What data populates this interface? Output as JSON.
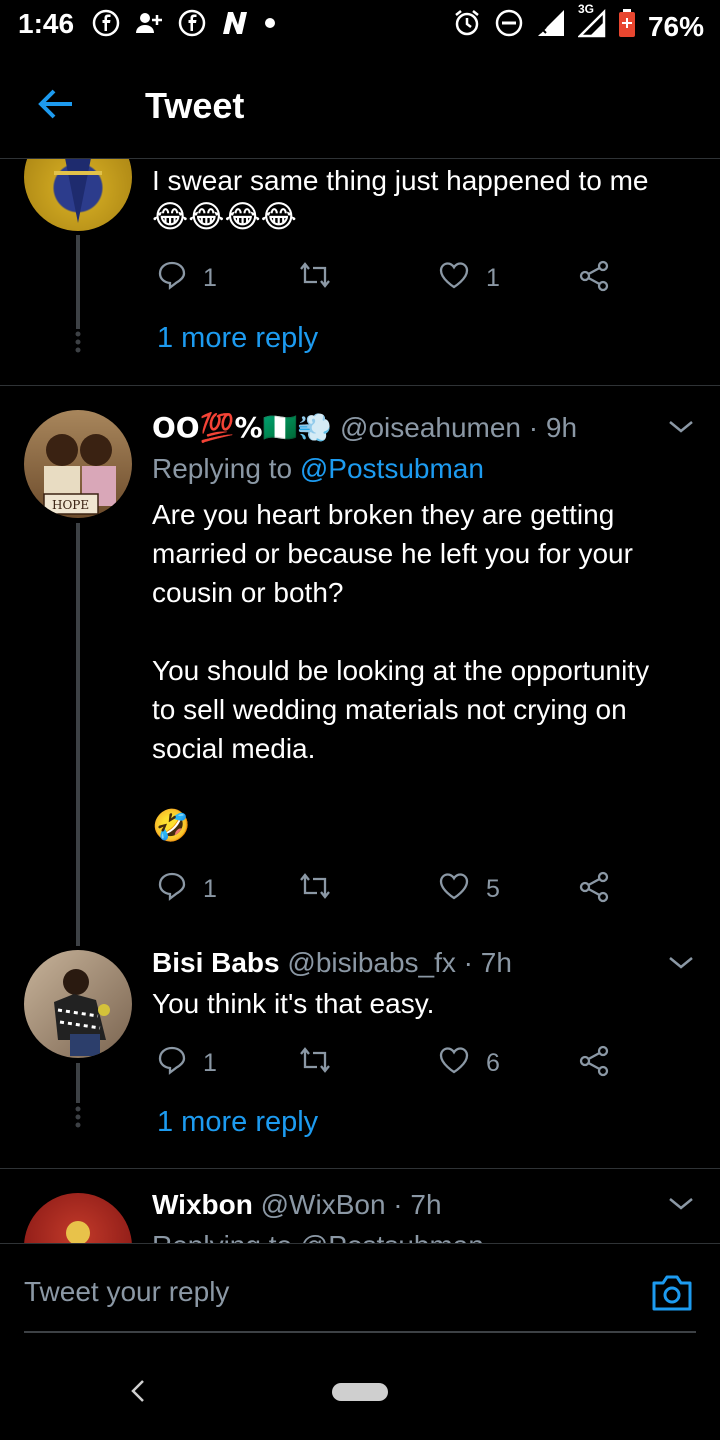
{
  "status_bar": {
    "time": "1:46",
    "signal_label": "3G",
    "battery": "76%",
    "icons_left": [
      "facebook-icon",
      "add-user-icon",
      "facebook-icon",
      "n-app-icon",
      "dot-icon"
    ],
    "icons_right": [
      "alarm-icon",
      "dnd-icon",
      "signal-icon",
      "signal-3g-icon",
      "battery-icon"
    ]
  },
  "header": {
    "title": "Tweet"
  },
  "tweets": [
    {
      "text_line1": "I swear same thing just happened to me",
      "emoji": "😂😂😂😂",
      "replies": "1",
      "likes": "1",
      "more_replies": "1 more reply"
    },
    {
      "name": "OO💯%🇳🇬💨",
      "handle": "@oiseahumen · 9h",
      "replying_prefix": "Replying to ",
      "replying_to": "@Postsubman",
      "text_p1_l1": "Are you heart broken they are getting",
      "text_p1_l2": "married or because he left you for your",
      "text_p1_l3": "cousin or both?",
      "text_p2_l1": "You should be looking at the opportunity",
      "text_p2_l2": "to sell wedding materials not crying on",
      "text_p2_l3": "social media.",
      "emoji": "🤣",
      "avatar_sign": "HOPE",
      "replies": "1",
      "likes": "5"
    },
    {
      "name": "Bisi Babs",
      "handle": "@bisibabs_fx · 7h",
      "text": "You think it's that easy.",
      "replies": "1",
      "likes": "6",
      "more_replies": "1 more reply"
    },
    {
      "name": "Wixbon",
      "handle": "@WixBon · 7h",
      "replying_partial": "Replying to @Postsubman"
    }
  ],
  "reply_bar": {
    "placeholder": "Tweet your reply"
  },
  "colors": {
    "background": "#000000",
    "accent": "#1d9bf0",
    "muted": "#8b98a5",
    "divider": "#2f3336"
  }
}
